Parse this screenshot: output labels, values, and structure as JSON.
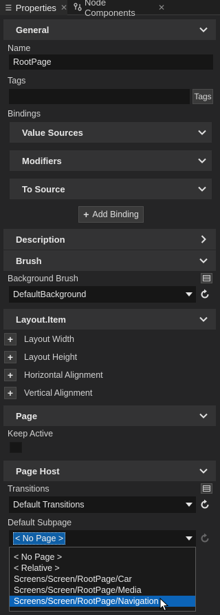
{
  "tabs": [
    {
      "label": "Properties",
      "icon": "list-icon",
      "active": true
    },
    {
      "label": "Node Components",
      "icon": "nodes-icon",
      "active": false
    }
  ],
  "sections": {
    "general": "General",
    "description": "Description",
    "brush": "Brush",
    "layout_item": "Layout.Item",
    "page": "Page",
    "page_host": "Page Host"
  },
  "general": {
    "name_label": "Name",
    "name_value": "RootPage",
    "tags_label": "Tags",
    "tags_value": "",
    "tags_button": "Tags",
    "bindings_label": "Bindings",
    "subsections": [
      "Value Sources",
      "Modifiers",
      "To Source"
    ],
    "add_binding": "Add Binding"
  },
  "brush": {
    "background_label": "Background Brush",
    "background_value": "DefaultBackground"
  },
  "layout_item": {
    "rows": [
      "Layout Width",
      "Layout Height",
      "Horizontal Alignment",
      "Vertical Alignment"
    ]
  },
  "page": {
    "keep_active_label": "Keep Active",
    "keep_active_checked": false
  },
  "page_host": {
    "transitions_label": "Transitions",
    "transitions_value": "Default Transitions",
    "default_subpage_label": "Default Subpage",
    "default_subpage_value": "< No Page >",
    "options": [
      "< No Page >",
      "< Relative >",
      "Screens/Screen/RootPage/Car",
      "Screens/Screen/RootPage/Media",
      "Screens/Screen/RootPage/Navigation"
    ],
    "highlighted_option_index": 4
  },
  "colors": {
    "panel": "#252526",
    "section": "#333334",
    "field": "#161616",
    "highlight": "#0c64b8"
  }
}
